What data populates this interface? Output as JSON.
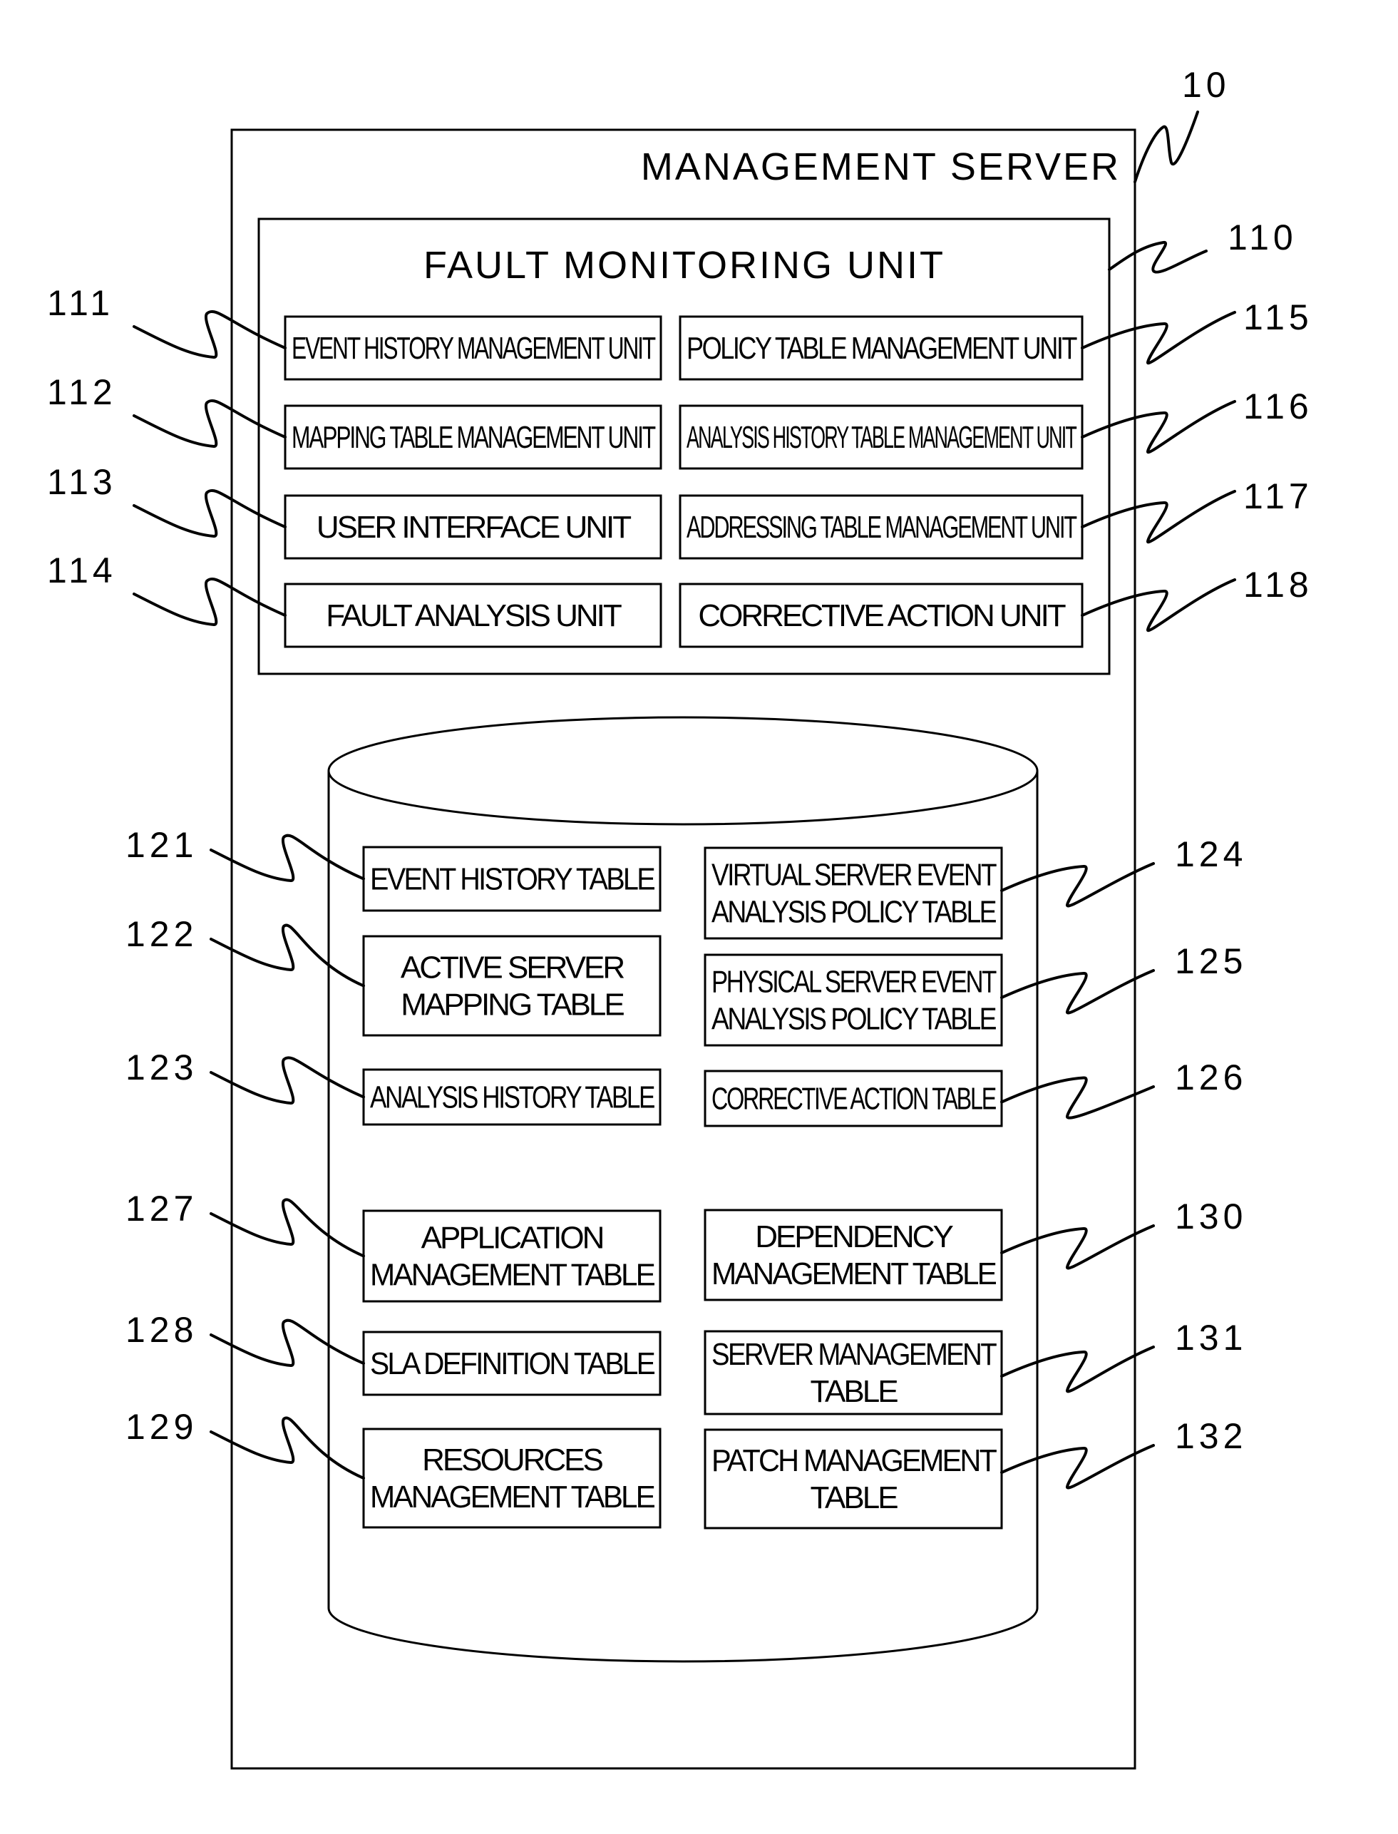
{
  "figure": {
    "server": {
      "ref": "10",
      "label": "MANAGEMENT SERVER"
    },
    "fault_monitoring_unit": {
      "ref": "110",
      "label": "FAULT MONITORING UNIT",
      "units_left": [
        {
          "ref": "111",
          "lines": [
            "EVENT HISTORY MANAGEMENT UNIT"
          ]
        },
        {
          "ref": "112",
          "lines": [
            "MAPPING TABLE MANAGEMENT UNIT"
          ]
        },
        {
          "ref": "113",
          "lines": [
            "USER INTERFACE UNIT"
          ]
        },
        {
          "ref": "114",
          "lines": [
            "FAULT ANALYSIS UNIT"
          ]
        }
      ],
      "units_right": [
        {
          "ref": "115",
          "lines": [
            "POLICY TABLE MANAGEMENT UNIT"
          ]
        },
        {
          "ref": "116",
          "lines": [
            "ANALYSIS HISTORY TABLE MANAGEMENT UNIT"
          ]
        },
        {
          "ref": "117",
          "lines": [
            "ADDRESSING TABLE MANAGEMENT UNIT"
          ]
        },
        {
          "ref": "118",
          "lines": [
            "CORRECTIVE ACTION UNIT"
          ]
        }
      ]
    },
    "storage": {
      "tables_left": [
        {
          "ref": "121",
          "lines": [
            "EVENT HISTORY TABLE"
          ]
        },
        {
          "ref": "122",
          "lines": [
            "ACTIVE SERVER",
            "MAPPING TABLE"
          ]
        },
        {
          "ref": "123",
          "lines": [
            "ANALYSIS HISTORY TABLE"
          ]
        },
        {
          "ref": "127",
          "lines": [
            "APPLICATION",
            "MANAGEMENT TABLE"
          ]
        },
        {
          "ref": "128",
          "lines": [
            "SLA DEFINITION TABLE"
          ]
        },
        {
          "ref": "129",
          "lines": [
            "RESOURCES",
            "MANAGEMENT TABLE"
          ]
        }
      ],
      "tables_right": [
        {
          "ref": "124",
          "lines": [
            "VIRTUAL SERVER EVENT",
            "ANALYSIS POLICY TABLE"
          ]
        },
        {
          "ref": "125",
          "lines": [
            "PHYSICAL SERVER EVENT",
            "ANALYSIS POLICY TABLE"
          ]
        },
        {
          "ref": "126",
          "lines": [
            "CORRECTIVE ACTION TABLE"
          ]
        },
        {
          "ref": "130",
          "lines": [
            "DEPENDENCY",
            "MANAGEMENT TABLE"
          ]
        },
        {
          "ref": "131",
          "lines": [
            "SERVER MANAGEMENT",
            "TABLE"
          ]
        },
        {
          "ref": "132",
          "lines": [
            "PATCH MANAGEMENT",
            "TABLE"
          ]
        }
      ]
    }
  }
}
